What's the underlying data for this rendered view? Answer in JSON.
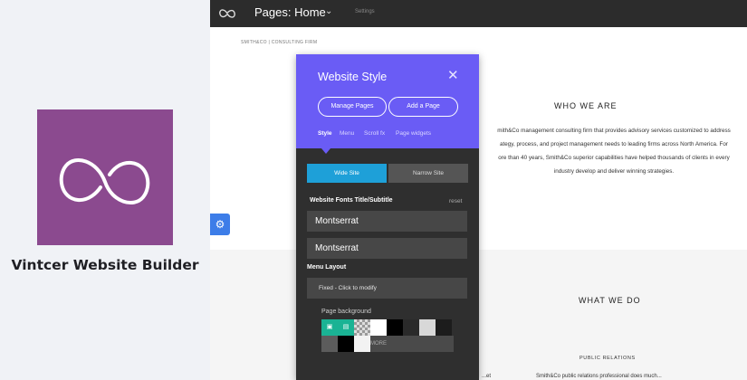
{
  "brand": {
    "name": "Vintcer Website Builder",
    "logo_color": "#8b4a8f"
  },
  "topbar": {
    "page_title": "Pages: Home",
    "settings_label": "Settings"
  },
  "site": {
    "header_text": "SMITH&CO | CONSULTING FIRM",
    "section1": {
      "title": "WHO WE ARE",
      "lines": [
        "mith&Co management consulting firm that provides advisory services customized to address",
        "ategy, process, and project management needs to leading firms across North America. For",
        "ore than 40 years, Smith&Co superior capabilities have helped thousands of clients in every",
        "industry develop and deliver winning strategies."
      ]
    },
    "section2": {
      "title": "WHAT WE DO",
      "subtitle": "PUBLIC RELATIONS",
      "fragment_left": "...et",
      "fragment_right": "Smith&Co public relations professional does much..."
    }
  },
  "panel": {
    "title": "Website Style",
    "manage_pages": "Manage Pages",
    "add_page": "Add a Page",
    "tabs": [
      "Style",
      "Menu",
      "Scroll fx",
      "Page widgets"
    ],
    "active_tab": "Style",
    "wide_site": "Wide Site",
    "narrow_site": "Narrow Site",
    "fonts_label": "Website Fonts Title/Subtitle",
    "reset": "reset",
    "title_font": "Montserrat",
    "subtitle_font": "Montserrat",
    "menu_layout_label": "Menu Layout",
    "menu_layout_value": "Fixed - Click to modify",
    "page_background_label": "Page background",
    "more_label": "MORE",
    "accent": "#6a5cf5",
    "selected_color": "#1ea0d8"
  }
}
